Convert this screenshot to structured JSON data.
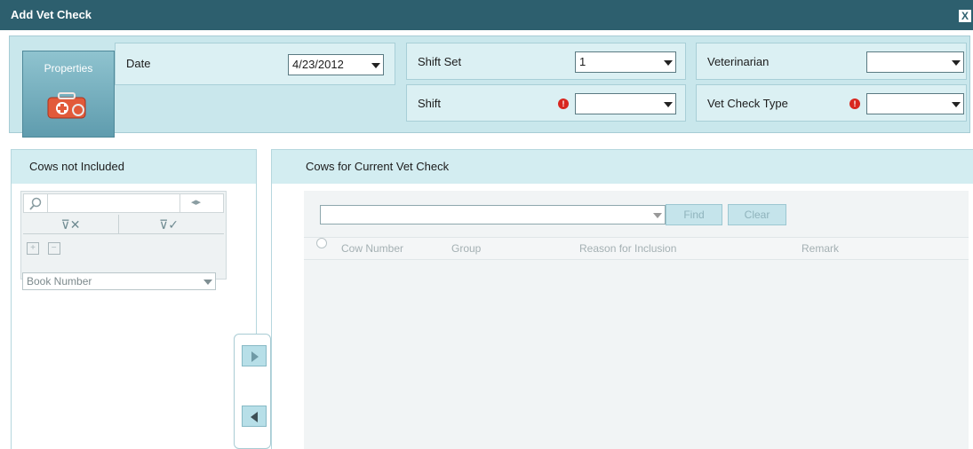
{
  "window": {
    "title": "Add Vet Check",
    "close_glyph": "X"
  },
  "properties": {
    "tile_label": "Properties",
    "tile_icon": "medical-kit-icon",
    "date": {
      "label": "Date",
      "value": "4/23/2012"
    },
    "shift_set": {
      "label": "Shift Set",
      "value": "1"
    },
    "shift": {
      "label": "Shift",
      "value": "",
      "required": true
    },
    "veterinarian": {
      "label": "Veterinarian",
      "value": ""
    },
    "vet_check_type": {
      "label": "Vet Check Type",
      "value": "",
      "required": true
    },
    "required_glyph": "!"
  },
  "left_panel": {
    "title": "Cows not Included",
    "search_value": "",
    "book_number": {
      "value": "Book Number"
    },
    "filter_clear_icon": "filter-clear-icon",
    "filter_apply_icon": "filter-apply-icon"
  },
  "transfer": {
    "add_icon": "arrow-right-icon",
    "remove_icon": "arrow-left-icon"
  },
  "right_panel": {
    "title": "Cows for Current Vet Check",
    "search_value": "",
    "find_label": "Find",
    "clear_label": "Clear",
    "columns": [
      "Cow Number",
      "Group",
      "Reason for Inclusion",
      "Remark"
    ],
    "rows": []
  },
  "colors": {
    "titlebar": "#2d5f6e",
    "panel_bg": "#c9e7ec",
    "required": "#d8271f"
  }
}
